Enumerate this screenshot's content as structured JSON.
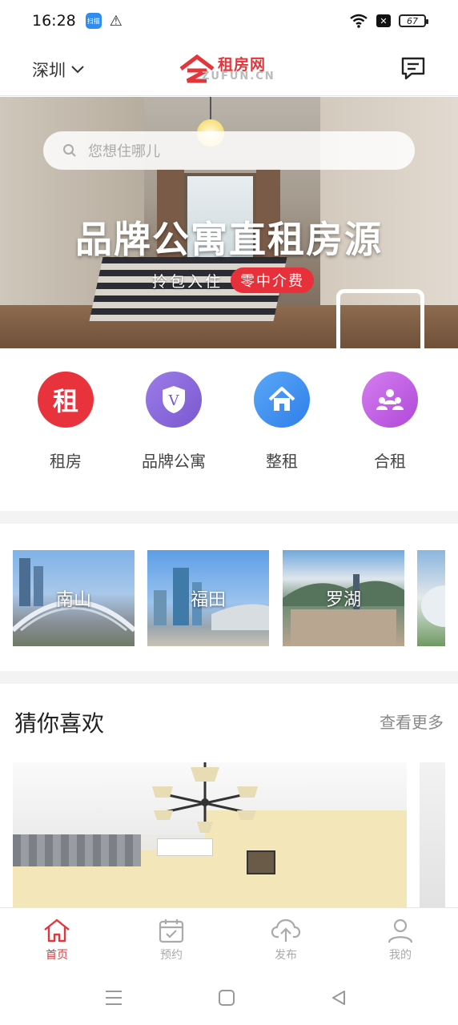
{
  "status_bar": {
    "time": "16:28",
    "app_badge": "扫描",
    "battery": "67"
  },
  "header": {
    "city": "深圳",
    "logo_cn": "租房网",
    "logo_en": "ZUFUN.CN"
  },
  "search": {
    "placeholder": "您想住哪儿"
  },
  "banner": {
    "title": "品牌公寓直租房源",
    "subtitle": "拎包入住",
    "tag": "零中介费"
  },
  "categories": [
    {
      "label": "租房",
      "icon": "rent-icon",
      "glyph": "租",
      "color": "#e8323c"
    },
    {
      "label": "品牌公寓",
      "icon": "brand-v-icon",
      "glyph": "V",
      "color": "#8a6ad8"
    },
    {
      "label": "整租",
      "icon": "house-icon",
      "glyph": "",
      "color": "#3d8ef0"
    },
    {
      "label": "合租",
      "icon": "group-icon",
      "glyph": "",
      "color": "#c061e0"
    }
  ],
  "districts": [
    {
      "label": "南山"
    },
    {
      "label": "福田"
    },
    {
      "label": "罗湖"
    },
    {
      "label": ""
    }
  ],
  "guess": {
    "title": "猜你喜欢",
    "more": "查看更多"
  },
  "tabs": [
    {
      "label": "首页",
      "icon": "home-icon",
      "active": true
    },
    {
      "label": "预约",
      "icon": "calendar-icon",
      "active": false
    },
    {
      "label": "发布",
      "icon": "upload-cloud-icon",
      "active": false
    },
    {
      "label": "我的",
      "icon": "user-icon",
      "active": false
    }
  ],
  "colors": {
    "brand": "#e4353a",
    "tab_inactive": "#aaaaaa"
  }
}
